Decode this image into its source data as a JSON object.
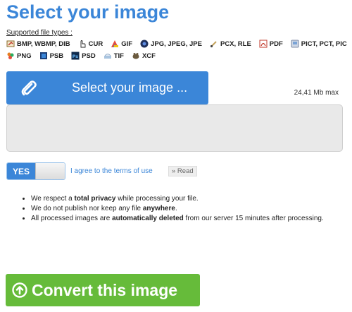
{
  "page": {
    "title": "Select your image",
    "supported_label": "Supported file types :"
  },
  "file_types": {
    "row1": [
      {
        "label": "BMP, WBMP, DIB",
        "icon": "paint-icon"
      },
      {
        "label": "CUR",
        "icon": "cursor-hand-icon"
      },
      {
        "label": "GIF",
        "icon": "gif-icon"
      },
      {
        "label": "JPG, JPEG, JPE",
        "icon": "camera-icon"
      },
      {
        "label": "PCX, RLE",
        "icon": "brush-icon"
      },
      {
        "label": "PDF",
        "icon": "pdf-icon"
      },
      {
        "label": "PICT, PCT, PIC",
        "icon": "pict-icon"
      }
    ],
    "row2": [
      {
        "label": "PNG",
        "icon": "png-icon"
      },
      {
        "label": "PSB",
        "icon": "psb-icon"
      },
      {
        "label": "PSD",
        "icon": "psd-icon"
      },
      {
        "label": "TIF",
        "icon": "tif-icon"
      },
      {
        "label": "XCF",
        "icon": "gimp-icon"
      }
    ]
  },
  "upload": {
    "button_label": "Select your image ...",
    "max_size": "24,41 Mb max"
  },
  "terms": {
    "toggle_label": "YES",
    "agree_text": "I agree to the terms of use",
    "read_label": "» Read"
  },
  "privacy": [
    {
      "pre": "We respect a ",
      "bold": "total privacy",
      "post": " while processing your file."
    },
    {
      "pre": "We do not publish nor keep any file ",
      "bold": "anywhere",
      "post": "."
    },
    {
      "pre": "All processed images are ",
      "bold": "automatically deleted",
      "post": " from our server 15 minutes after processing."
    }
  ],
  "convert": {
    "button_label": "Convert this image"
  },
  "colors": {
    "accent_blue": "#3b86d8",
    "convert_green": "#66bb3a",
    "dropzone_bg": "#e9e9e9"
  }
}
